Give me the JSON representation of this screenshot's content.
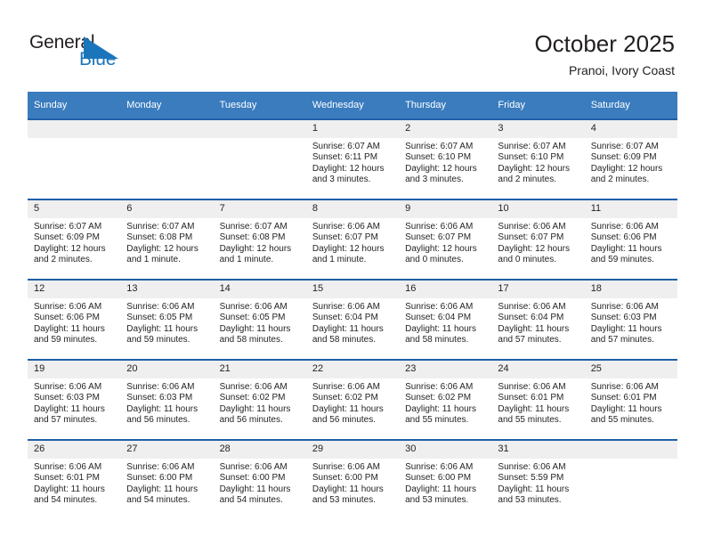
{
  "brand": {
    "name_line1": "General",
    "name_line2": "Blue",
    "flag_icon": "triangle-flag-icon",
    "color_dark": "#231f20",
    "color_blue": "#1b75bb"
  },
  "header": {
    "title": "October 2025",
    "subtitle": "Pranoi, Ivory Coast"
  },
  "theme": {
    "header_bg": "#3a7cbe",
    "row_divider": "#1f5fa6",
    "daynum_bg": "#efefef",
    "text": "#231f20"
  },
  "weekdays": [
    "Sunday",
    "Monday",
    "Tuesday",
    "Wednesday",
    "Thursday",
    "Friday",
    "Saturday"
  ],
  "weeks": [
    [
      {
        "day": "",
        "sunrise": "",
        "sunset": "",
        "daylight_line1": "",
        "daylight_line2": ""
      },
      {
        "day": "",
        "sunrise": "",
        "sunset": "",
        "daylight_line1": "",
        "daylight_line2": ""
      },
      {
        "day": "",
        "sunrise": "",
        "sunset": "",
        "daylight_line1": "",
        "daylight_line2": ""
      },
      {
        "day": "1",
        "sunrise": "Sunrise: 6:07 AM",
        "sunset": "Sunset: 6:11 PM",
        "daylight_line1": "Daylight: 12 hours",
        "daylight_line2": "and 3 minutes."
      },
      {
        "day": "2",
        "sunrise": "Sunrise: 6:07 AM",
        "sunset": "Sunset: 6:10 PM",
        "daylight_line1": "Daylight: 12 hours",
        "daylight_line2": "and 3 minutes."
      },
      {
        "day": "3",
        "sunrise": "Sunrise: 6:07 AM",
        "sunset": "Sunset: 6:10 PM",
        "daylight_line1": "Daylight: 12 hours",
        "daylight_line2": "and 2 minutes."
      },
      {
        "day": "4",
        "sunrise": "Sunrise: 6:07 AM",
        "sunset": "Sunset: 6:09 PM",
        "daylight_line1": "Daylight: 12 hours",
        "daylight_line2": "and 2 minutes."
      }
    ],
    [
      {
        "day": "5",
        "sunrise": "Sunrise: 6:07 AM",
        "sunset": "Sunset: 6:09 PM",
        "daylight_line1": "Daylight: 12 hours",
        "daylight_line2": "and 2 minutes."
      },
      {
        "day": "6",
        "sunrise": "Sunrise: 6:07 AM",
        "sunset": "Sunset: 6:08 PM",
        "daylight_line1": "Daylight: 12 hours",
        "daylight_line2": "and 1 minute."
      },
      {
        "day": "7",
        "sunrise": "Sunrise: 6:07 AM",
        "sunset": "Sunset: 6:08 PM",
        "daylight_line1": "Daylight: 12 hours",
        "daylight_line2": "and 1 minute."
      },
      {
        "day": "8",
        "sunrise": "Sunrise: 6:06 AM",
        "sunset": "Sunset: 6:07 PM",
        "daylight_line1": "Daylight: 12 hours",
        "daylight_line2": "and 1 minute."
      },
      {
        "day": "9",
        "sunrise": "Sunrise: 6:06 AM",
        "sunset": "Sunset: 6:07 PM",
        "daylight_line1": "Daylight: 12 hours",
        "daylight_line2": "and 0 minutes."
      },
      {
        "day": "10",
        "sunrise": "Sunrise: 6:06 AM",
        "sunset": "Sunset: 6:07 PM",
        "daylight_line1": "Daylight: 12 hours",
        "daylight_line2": "and 0 minutes."
      },
      {
        "day": "11",
        "sunrise": "Sunrise: 6:06 AM",
        "sunset": "Sunset: 6:06 PM",
        "daylight_line1": "Daylight: 11 hours",
        "daylight_line2": "and 59 minutes."
      }
    ],
    [
      {
        "day": "12",
        "sunrise": "Sunrise: 6:06 AM",
        "sunset": "Sunset: 6:06 PM",
        "daylight_line1": "Daylight: 11 hours",
        "daylight_line2": "and 59 minutes."
      },
      {
        "day": "13",
        "sunrise": "Sunrise: 6:06 AM",
        "sunset": "Sunset: 6:05 PM",
        "daylight_line1": "Daylight: 11 hours",
        "daylight_line2": "and 59 minutes."
      },
      {
        "day": "14",
        "sunrise": "Sunrise: 6:06 AM",
        "sunset": "Sunset: 6:05 PM",
        "daylight_line1": "Daylight: 11 hours",
        "daylight_line2": "and 58 minutes."
      },
      {
        "day": "15",
        "sunrise": "Sunrise: 6:06 AM",
        "sunset": "Sunset: 6:04 PM",
        "daylight_line1": "Daylight: 11 hours",
        "daylight_line2": "and 58 minutes."
      },
      {
        "day": "16",
        "sunrise": "Sunrise: 6:06 AM",
        "sunset": "Sunset: 6:04 PM",
        "daylight_line1": "Daylight: 11 hours",
        "daylight_line2": "and 58 minutes."
      },
      {
        "day": "17",
        "sunrise": "Sunrise: 6:06 AM",
        "sunset": "Sunset: 6:04 PM",
        "daylight_line1": "Daylight: 11 hours",
        "daylight_line2": "and 57 minutes."
      },
      {
        "day": "18",
        "sunrise": "Sunrise: 6:06 AM",
        "sunset": "Sunset: 6:03 PM",
        "daylight_line1": "Daylight: 11 hours",
        "daylight_line2": "and 57 minutes."
      }
    ],
    [
      {
        "day": "19",
        "sunrise": "Sunrise: 6:06 AM",
        "sunset": "Sunset: 6:03 PM",
        "daylight_line1": "Daylight: 11 hours",
        "daylight_line2": "and 57 minutes."
      },
      {
        "day": "20",
        "sunrise": "Sunrise: 6:06 AM",
        "sunset": "Sunset: 6:03 PM",
        "daylight_line1": "Daylight: 11 hours",
        "daylight_line2": "and 56 minutes."
      },
      {
        "day": "21",
        "sunrise": "Sunrise: 6:06 AM",
        "sunset": "Sunset: 6:02 PM",
        "daylight_line1": "Daylight: 11 hours",
        "daylight_line2": "and 56 minutes."
      },
      {
        "day": "22",
        "sunrise": "Sunrise: 6:06 AM",
        "sunset": "Sunset: 6:02 PM",
        "daylight_line1": "Daylight: 11 hours",
        "daylight_line2": "and 56 minutes."
      },
      {
        "day": "23",
        "sunrise": "Sunrise: 6:06 AM",
        "sunset": "Sunset: 6:02 PM",
        "daylight_line1": "Daylight: 11 hours",
        "daylight_line2": "and 55 minutes."
      },
      {
        "day": "24",
        "sunrise": "Sunrise: 6:06 AM",
        "sunset": "Sunset: 6:01 PM",
        "daylight_line1": "Daylight: 11 hours",
        "daylight_line2": "and 55 minutes."
      },
      {
        "day": "25",
        "sunrise": "Sunrise: 6:06 AM",
        "sunset": "Sunset: 6:01 PM",
        "daylight_line1": "Daylight: 11 hours",
        "daylight_line2": "and 55 minutes."
      }
    ],
    [
      {
        "day": "26",
        "sunrise": "Sunrise: 6:06 AM",
        "sunset": "Sunset: 6:01 PM",
        "daylight_line1": "Daylight: 11 hours",
        "daylight_line2": "and 54 minutes."
      },
      {
        "day": "27",
        "sunrise": "Sunrise: 6:06 AM",
        "sunset": "Sunset: 6:00 PM",
        "daylight_line1": "Daylight: 11 hours",
        "daylight_line2": "and 54 minutes."
      },
      {
        "day": "28",
        "sunrise": "Sunrise: 6:06 AM",
        "sunset": "Sunset: 6:00 PM",
        "daylight_line1": "Daylight: 11 hours",
        "daylight_line2": "and 54 minutes."
      },
      {
        "day": "29",
        "sunrise": "Sunrise: 6:06 AM",
        "sunset": "Sunset: 6:00 PM",
        "daylight_line1": "Daylight: 11 hours",
        "daylight_line2": "and 53 minutes."
      },
      {
        "day": "30",
        "sunrise": "Sunrise: 6:06 AM",
        "sunset": "Sunset: 6:00 PM",
        "daylight_line1": "Daylight: 11 hours",
        "daylight_line2": "and 53 minutes."
      },
      {
        "day": "31",
        "sunrise": "Sunrise: 6:06 AM",
        "sunset": "Sunset: 5:59 PM",
        "daylight_line1": "Daylight: 11 hours",
        "daylight_line2": "and 53 minutes."
      },
      {
        "day": "",
        "sunrise": "",
        "sunset": "",
        "daylight_line1": "",
        "daylight_line2": ""
      }
    ]
  ]
}
